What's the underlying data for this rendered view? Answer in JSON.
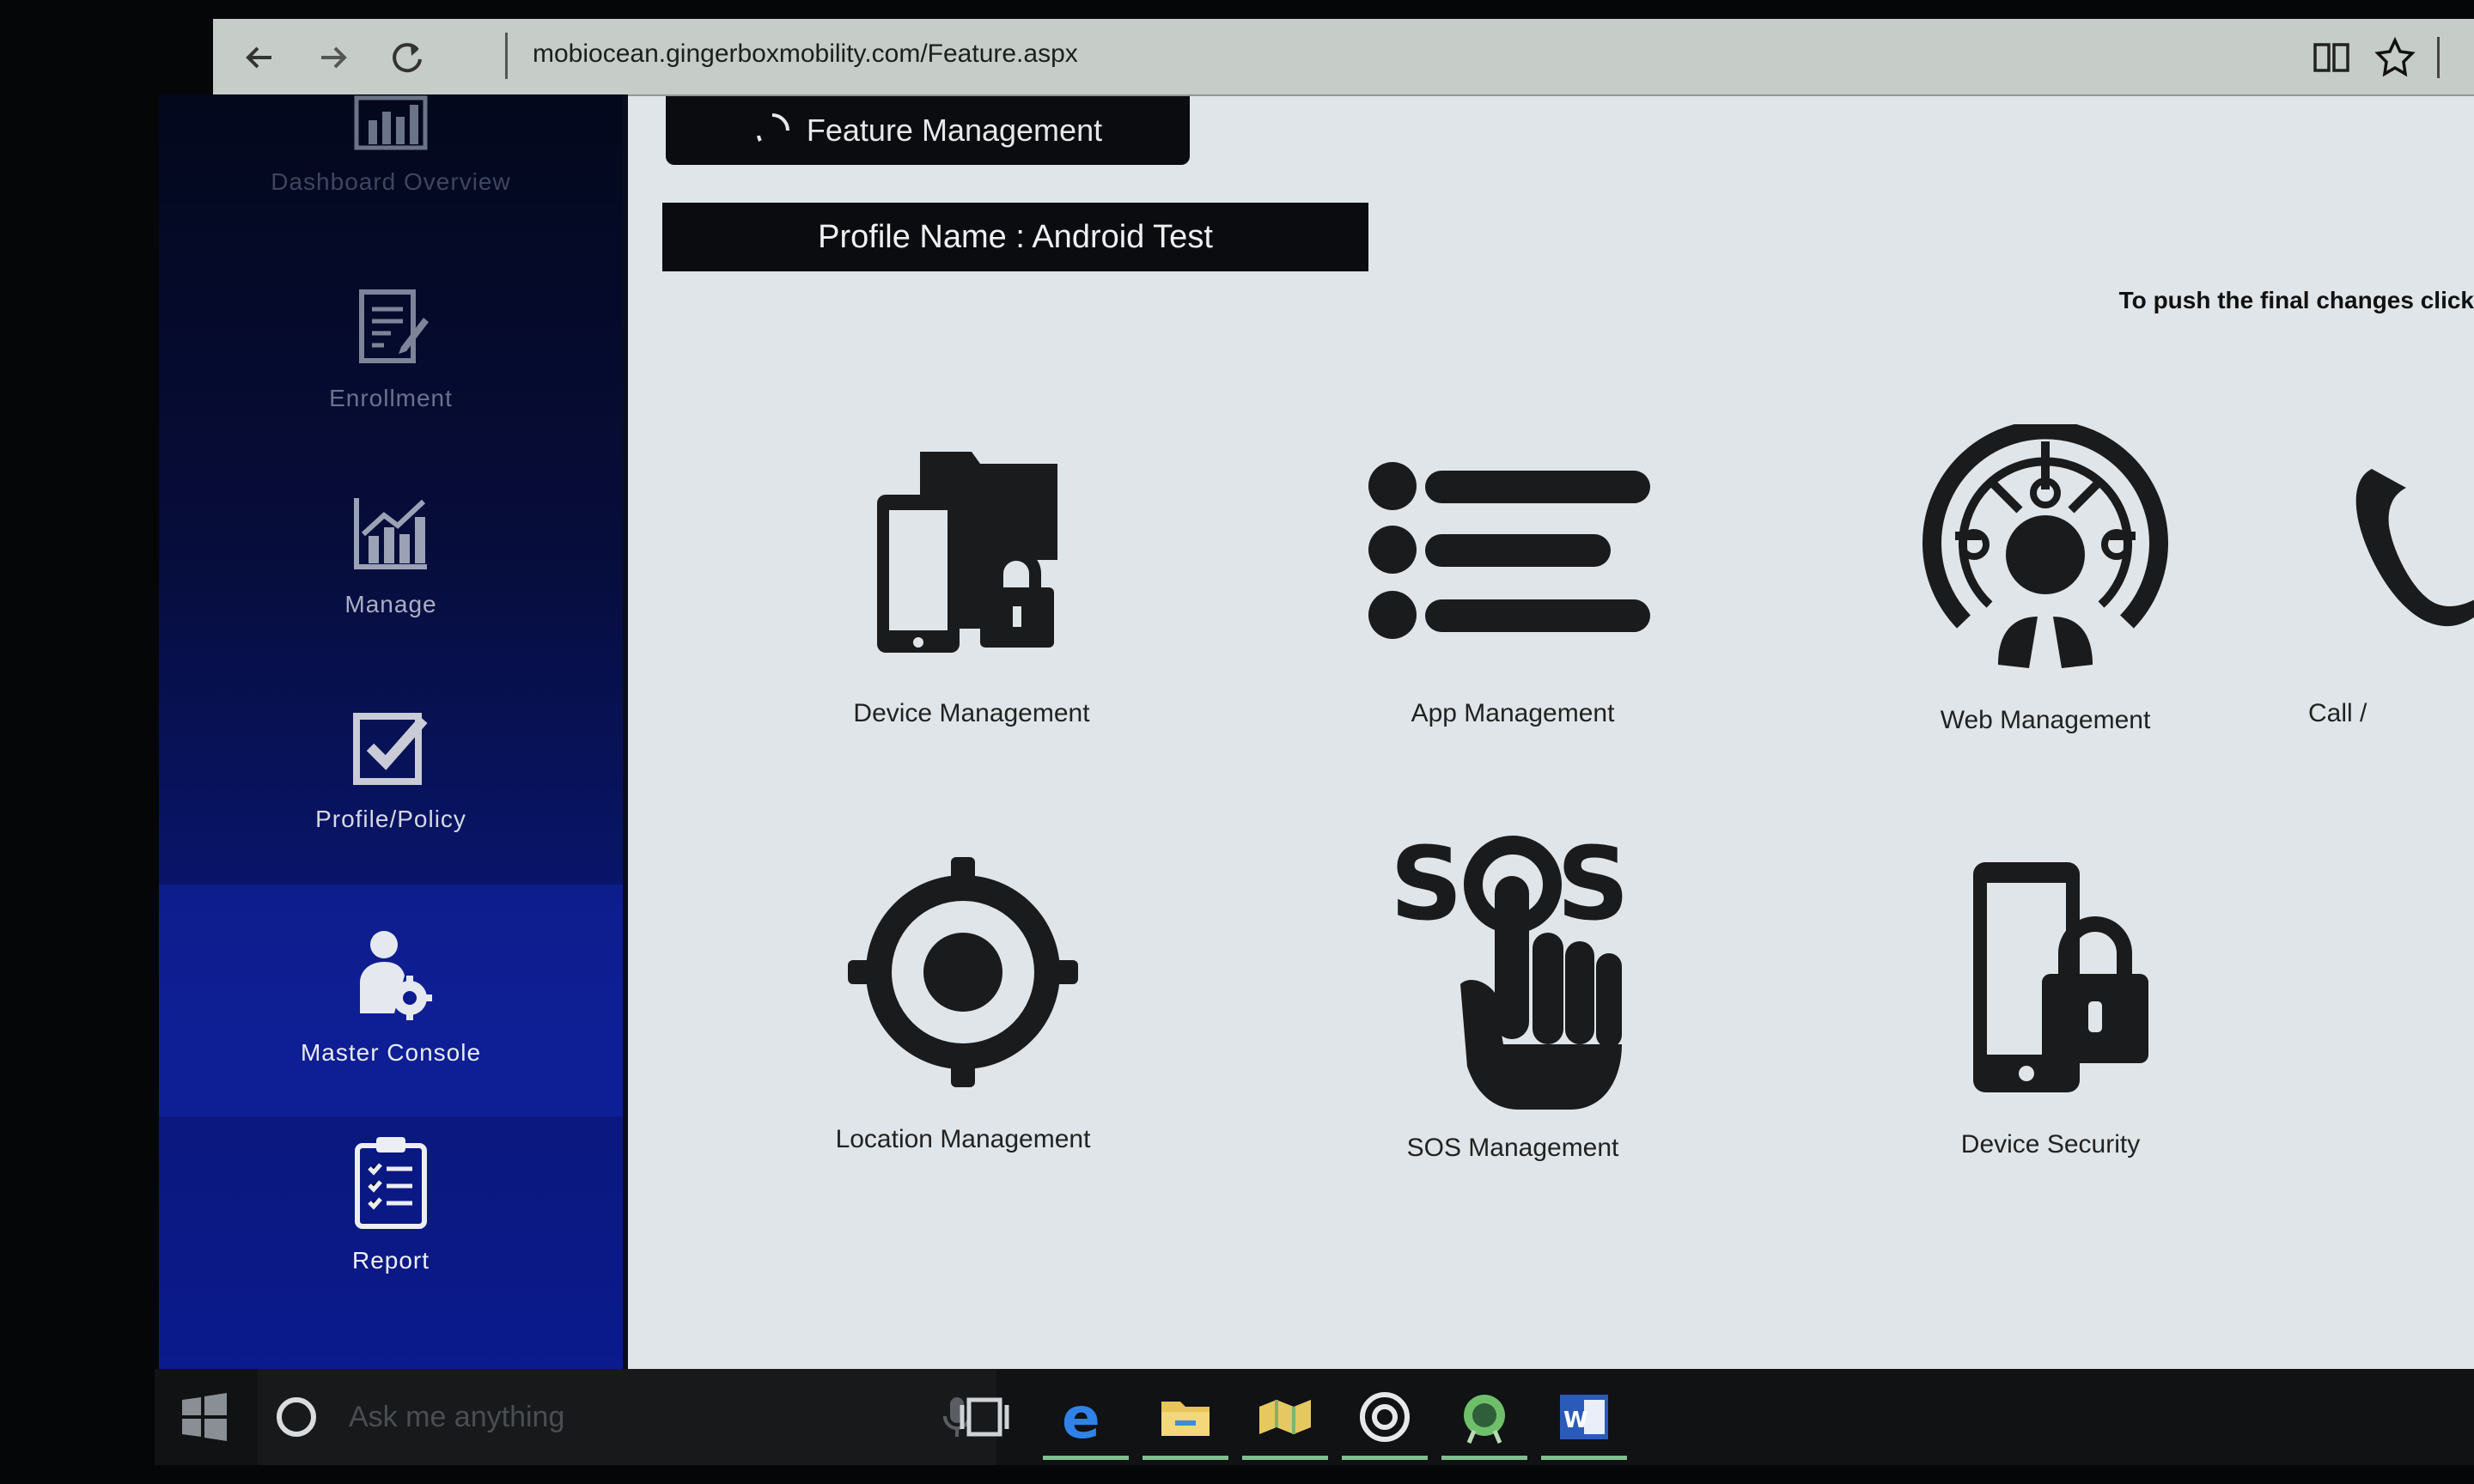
{
  "browser": {
    "url": "mobiocean.gingerboxmobility.com/Feature.aspx"
  },
  "sidebar": {
    "items": [
      {
        "label": "Dashboard Overview",
        "icon": "bar-chart-icon"
      },
      {
        "label": "Enrollment",
        "icon": "document-edit-icon"
      },
      {
        "label": "Manage",
        "icon": "chart-trend-icon"
      },
      {
        "label": "Profile/Policy",
        "icon": "checkbox-icon"
      },
      {
        "label": "Master Console",
        "icon": "user-gear-icon"
      },
      {
        "label": "Report",
        "icon": "clipboard-checklist-icon"
      }
    ]
  },
  "main": {
    "tab_title": "Feature Management",
    "profile_name": "Profile Name : Android Test",
    "push_note": "To push the final changes click",
    "features": [
      {
        "label": "Device Management",
        "icon": "devices-lock-icon"
      },
      {
        "label": "App Management",
        "icon": "list-icon"
      },
      {
        "label": "Web Management",
        "icon": "globe-network-icon"
      },
      {
        "label": "Call /",
        "icon": "phone-icon"
      },
      {
        "label": "Location Management",
        "icon": "target-icon"
      },
      {
        "label": "SOS Management",
        "icon": "sos-hand-icon"
      },
      {
        "label": "Device Security",
        "icon": "phone-lock-icon"
      }
    ]
  },
  "taskbar": {
    "search_placeholder": "Ask me anything"
  },
  "colors": {
    "sidebar_top": "#04081c",
    "sidebar_bottom": "#0b1a8c",
    "main_bg": "#dfe5e8",
    "header_box": "#0b0c10"
  }
}
